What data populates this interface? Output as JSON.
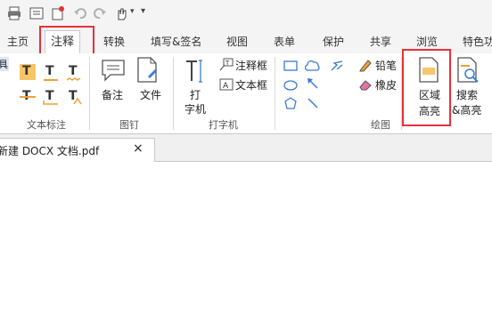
{
  "tabs": {
    "home": "主页",
    "annotate": "注释",
    "convert": "转换",
    "fill_sign": "填写&签名",
    "view": "视图",
    "form": "表单",
    "protect": "保护",
    "share": "共享",
    "browse": "浏览",
    "features": "特色功"
  },
  "ribbon": {
    "partial_left": "具",
    "groups": {
      "text_markup": "文本标注",
      "pin": "图钉",
      "typewriter": "打字机",
      "drawing": "绘图"
    },
    "buttons": {
      "note": "备注",
      "file": "文件",
      "typewriter_line1": "打",
      "typewriter_line2": "字机",
      "callout": "注释框",
      "textbox": "文本框",
      "pencil": "铅笔",
      "eraser": "橡皮",
      "area_highlight_line1": "区域",
      "area_highlight_line2": "高亮",
      "search_highlight_line1": "搜索",
      "search_highlight_line2": "&高亮"
    }
  },
  "document": {
    "tab_title": "新建 DOCX 文档.pdf",
    "close_glyph": "×"
  },
  "colors": {
    "highlight_box": "#e8303a",
    "text_markup_icon": "#f0a030"
  }
}
